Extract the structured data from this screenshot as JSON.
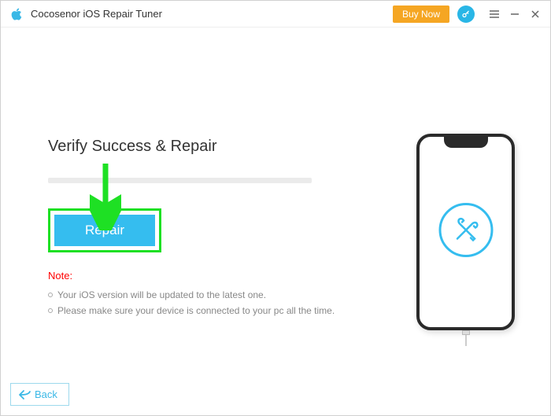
{
  "titlebar": {
    "app_title": "Cocosenor iOS Repair Tuner",
    "buy_now": "Buy Now"
  },
  "main": {
    "heading": "Verify Success & Repair",
    "repair_button": "Repair",
    "note_label": "Note:",
    "notes": [
      "Your iOS version will be updated to the latest one.",
      "Please make sure your device is connected to your pc all the time."
    ]
  },
  "footer": {
    "back": "Back"
  }
}
